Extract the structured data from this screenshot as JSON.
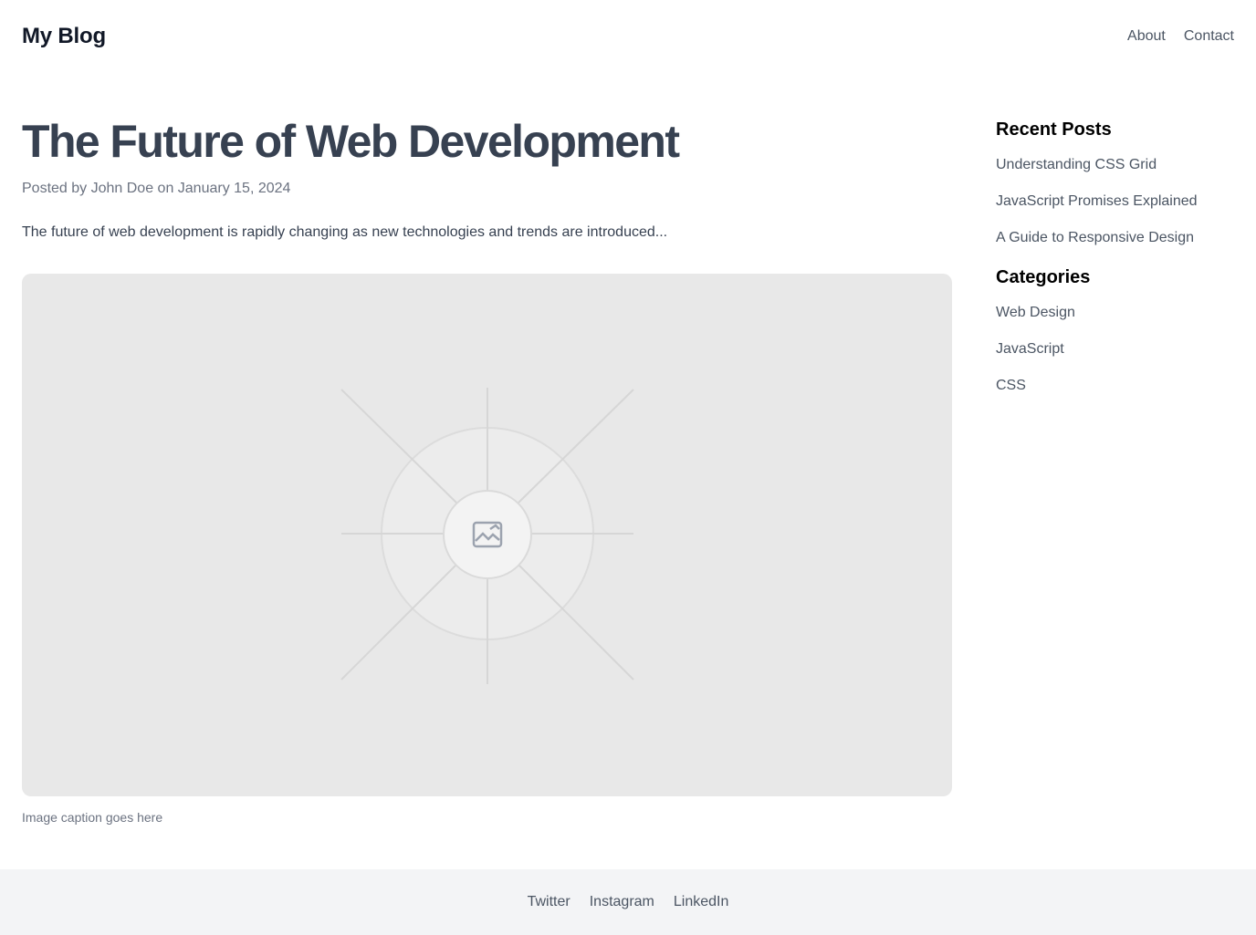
{
  "header": {
    "logo": "My Blog",
    "nav": [
      "About",
      "Contact"
    ]
  },
  "article": {
    "title": "The Future of Web Development",
    "meta": "Posted by John Doe on January 15, 2024",
    "excerpt": "The future of web development is rapidly changing as new technologies and trends are introduced...",
    "image_caption": "Image caption goes here",
    "image_icon": "image-placeholder-icon"
  },
  "sidebar": {
    "recent_heading": "Recent Posts",
    "recent_posts": [
      "Understanding CSS Grid",
      "JavaScript Promises Explained",
      "A Guide to Responsive Design"
    ],
    "categories_heading": "Categories",
    "categories": [
      "Web Design",
      "JavaScript",
      "CSS"
    ]
  },
  "footer": {
    "links": [
      "Twitter",
      "Instagram",
      "LinkedIn"
    ]
  },
  "colors": {
    "heading": "#374151",
    "text": "#4b5563",
    "muted": "#6b7280",
    "image_bg": "#e8e8e8",
    "footer_bg": "#f3f4f6"
  }
}
